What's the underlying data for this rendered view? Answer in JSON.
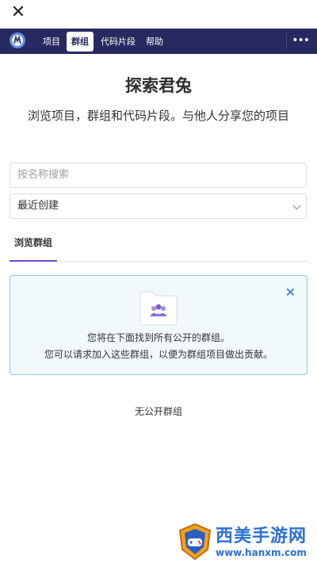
{
  "topbar": {
    "close_glyph": "✕"
  },
  "nav": {
    "items": [
      {
        "label": "项目",
        "active": false
      },
      {
        "label": "群组",
        "active": true
      },
      {
        "label": "代码片段",
        "active": false
      },
      {
        "label": "帮助",
        "active": false
      }
    ],
    "more_glyph": "•••",
    "color": "#292961"
  },
  "page": {
    "title": "探索君兔",
    "subtitle": "浏览项目，群组和代码片段。与他人分享您的项目"
  },
  "filters": {
    "search_placeholder": "按名称搜索",
    "sort_value": "最近创建"
  },
  "tabs": [
    {
      "label": "浏览群组",
      "active": true
    }
  ],
  "alert": {
    "line1": "您将在下面找到所有公开的群组。",
    "line2": "您可以请求加入这些群组，以便为群组项目做出贡献。",
    "close_glyph": "✕"
  },
  "empty_message": "无公开群组",
  "watermark": {
    "text": "西美手游网",
    "url": "www.hanxm.com"
  },
  "colors": {
    "accent": "#6e49cb",
    "info_border": "#8fc7e6",
    "info_bg": "#f2f9fc",
    "link": "#1f78d1"
  }
}
